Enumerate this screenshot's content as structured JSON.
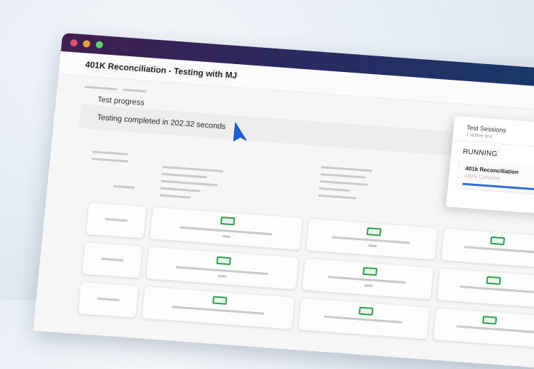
{
  "window": {
    "title": "401K Reconciliation - Testing with MJ"
  },
  "progress": {
    "heading": "Test progress",
    "message": "Testing completed in 202.32 seconds"
  },
  "sessions": {
    "title": "Test Sessions",
    "subtitle": "1 active test",
    "status": "RUNNING",
    "items": [
      {
        "name": "401k Reconciliation",
        "percent_label": "100% Complete",
        "progress": 1.0
      }
    ]
  },
  "colors": {
    "titlebar_start": "#3f1f4f",
    "titlebar_end": "#163a6c",
    "cursor": "#1f5fd6",
    "status_pill": "#2e9d4c",
    "session_progress": "#2f6fd6"
  },
  "icons": {
    "cursor": "pointer-cursor-icon"
  }
}
